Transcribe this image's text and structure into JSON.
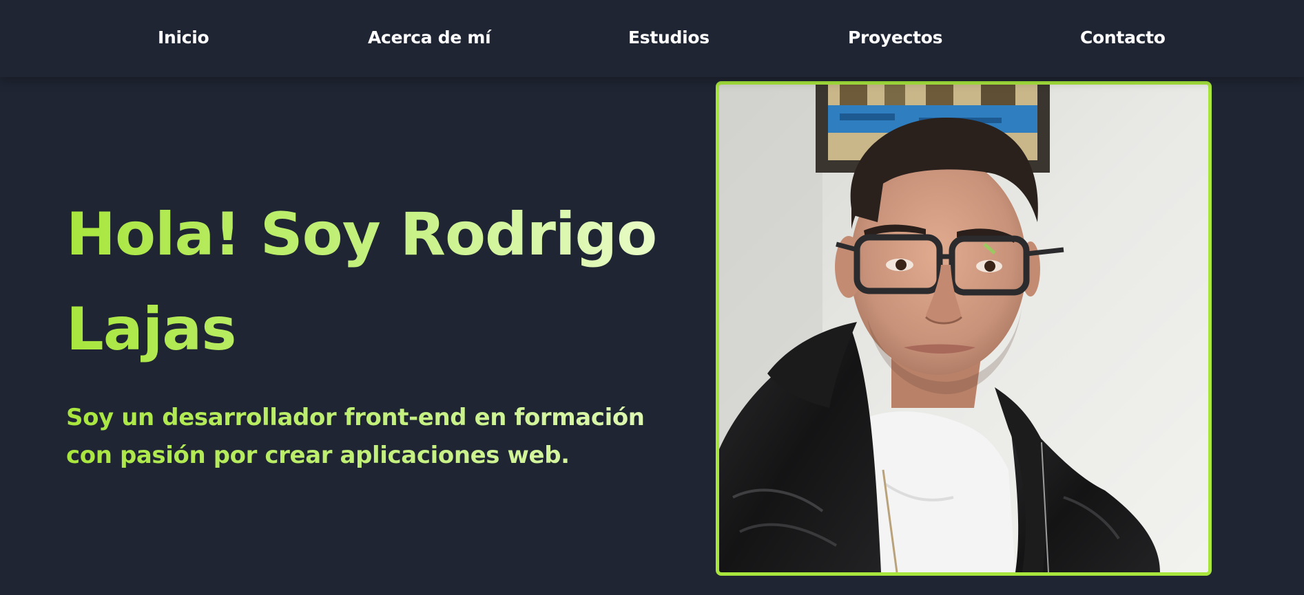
{
  "nav": {
    "items": [
      {
        "label": "Inicio"
      },
      {
        "label": "Acerca de mí"
      },
      {
        "label": "Estudios"
      },
      {
        "label": "Proyectos"
      },
      {
        "label": "Contacto"
      }
    ]
  },
  "hero": {
    "title": "Hola! Soy Rodrigo Lajas",
    "subtitle": "Soy un desarrollador front-end en formación con pasión por crear aplicaciones web."
  },
  "colors": {
    "background": "#1f2533",
    "accent": "#a8e63d",
    "nav_text": "#ffffff"
  }
}
